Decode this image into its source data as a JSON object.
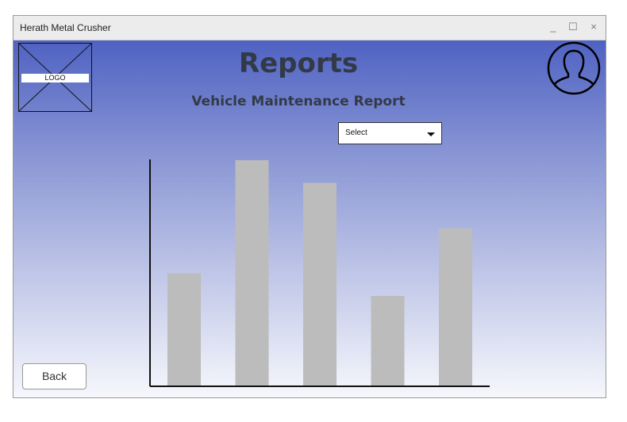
{
  "window": {
    "title": "Herath Metal Crusher",
    "controls": {
      "minimize": "_",
      "maximize": "☐",
      "close": "×"
    }
  },
  "logo": {
    "label": "LOGO"
  },
  "header": {
    "title": "Reports",
    "subtitle": "Vehicle Maintenance Report"
  },
  "filter": {
    "selected": "Select"
  },
  "chart_data": {
    "type": "bar",
    "values": [
      50,
      100,
      90,
      40,
      70
    ],
    "ylim": [
      0,
      100
    ],
    "bar_color": "#bcbcbc",
    "axis_color": "#111111"
  },
  "footer": {
    "back_label": "Back"
  }
}
